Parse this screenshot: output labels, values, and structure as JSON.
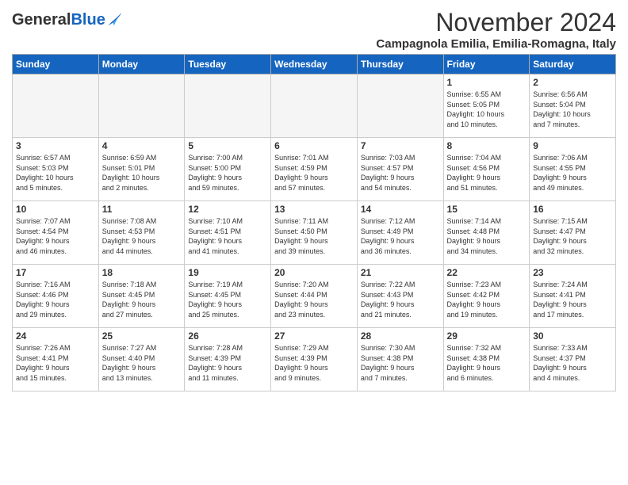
{
  "logo": {
    "general": "General",
    "blue": "Blue"
  },
  "title": "November 2024",
  "location": "Campagnola Emilia, Emilia-Romagna, Italy",
  "weekdays": [
    "Sunday",
    "Monday",
    "Tuesday",
    "Wednesday",
    "Thursday",
    "Friday",
    "Saturday"
  ],
  "weeks": [
    [
      {
        "day": null,
        "info": null
      },
      {
        "day": null,
        "info": null
      },
      {
        "day": null,
        "info": null
      },
      {
        "day": null,
        "info": null
      },
      {
        "day": null,
        "info": null
      },
      {
        "day": "1",
        "info": "Sunrise: 6:55 AM\nSunset: 5:05 PM\nDaylight: 10 hours\nand 10 minutes."
      },
      {
        "day": "2",
        "info": "Sunrise: 6:56 AM\nSunset: 5:04 PM\nDaylight: 10 hours\nand 7 minutes."
      }
    ],
    [
      {
        "day": "3",
        "info": "Sunrise: 6:57 AM\nSunset: 5:03 PM\nDaylight: 10 hours\nand 5 minutes."
      },
      {
        "day": "4",
        "info": "Sunrise: 6:59 AM\nSunset: 5:01 PM\nDaylight: 10 hours\nand 2 minutes."
      },
      {
        "day": "5",
        "info": "Sunrise: 7:00 AM\nSunset: 5:00 PM\nDaylight: 9 hours\nand 59 minutes."
      },
      {
        "day": "6",
        "info": "Sunrise: 7:01 AM\nSunset: 4:59 PM\nDaylight: 9 hours\nand 57 minutes."
      },
      {
        "day": "7",
        "info": "Sunrise: 7:03 AM\nSunset: 4:57 PM\nDaylight: 9 hours\nand 54 minutes."
      },
      {
        "day": "8",
        "info": "Sunrise: 7:04 AM\nSunset: 4:56 PM\nDaylight: 9 hours\nand 51 minutes."
      },
      {
        "day": "9",
        "info": "Sunrise: 7:06 AM\nSunset: 4:55 PM\nDaylight: 9 hours\nand 49 minutes."
      }
    ],
    [
      {
        "day": "10",
        "info": "Sunrise: 7:07 AM\nSunset: 4:54 PM\nDaylight: 9 hours\nand 46 minutes."
      },
      {
        "day": "11",
        "info": "Sunrise: 7:08 AM\nSunset: 4:53 PM\nDaylight: 9 hours\nand 44 minutes."
      },
      {
        "day": "12",
        "info": "Sunrise: 7:10 AM\nSunset: 4:51 PM\nDaylight: 9 hours\nand 41 minutes."
      },
      {
        "day": "13",
        "info": "Sunrise: 7:11 AM\nSunset: 4:50 PM\nDaylight: 9 hours\nand 39 minutes."
      },
      {
        "day": "14",
        "info": "Sunrise: 7:12 AM\nSunset: 4:49 PM\nDaylight: 9 hours\nand 36 minutes."
      },
      {
        "day": "15",
        "info": "Sunrise: 7:14 AM\nSunset: 4:48 PM\nDaylight: 9 hours\nand 34 minutes."
      },
      {
        "day": "16",
        "info": "Sunrise: 7:15 AM\nSunset: 4:47 PM\nDaylight: 9 hours\nand 32 minutes."
      }
    ],
    [
      {
        "day": "17",
        "info": "Sunrise: 7:16 AM\nSunset: 4:46 PM\nDaylight: 9 hours\nand 29 minutes."
      },
      {
        "day": "18",
        "info": "Sunrise: 7:18 AM\nSunset: 4:45 PM\nDaylight: 9 hours\nand 27 minutes."
      },
      {
        "day": "19",
        "info": "Sunrise: 7:19 AM\nSunset: 4:45 PM\nDaylight: 9 hours\nand 25 minutes."
      },
      {
        "day": "20",
        "info": "Sunrise: 7:20 AM\nSunset: 4:44 PM\nDaylight: 9 hours\nand 23 minutes."
      },
      {
        "day": "21",
        "info": "Sunrise: 7:22 AM\nSunset: 4:43 PM\nDaylight: 9 hours\nand 21 minutes."
      },
      {
        "day": "22",
        "info": "Sunrise: 7:23 AM\nSunset: 4:42 PM\nDaylight: 9 hours\nand 19 minutes."
      },
      {
        "day": "23",
        "info": "Sunrise: 7:24 AM\nSunset: 4:41 PM\nDaylight: 9 hours\nand 17 minutes."
      }
    ],
    [
      {
        "day": "24",
        "info": "Sunrise: 7:26 AM\nSunset: 4:41 PM\nDaylight: 9 hours\nand 15 minutes."
      },
      {
        "day": "25",
        "info": "Sunrise: 7:27 AM\nSunset: 4:40 PM\nDaylight: 9 hours\nand 13 minutes."
      },
      {
        "day": "26",
        "info": "Sunrise: 7:28 AM\nSunset: 4:39 PM\nDaylight: 9 hours\nand 11 minutes."
      },
      {
        "day": "27",
        "info": "Sunrise: 7:29 AM\nSunset: 4:39 PM\nDaylight: 9 hours\nand 9 minutes."
      },
      {
        "day": "28",
        "info": "Sunrise: 7:30 AM\nSunset: 4:38 PM\nDaylight: 9 hours\nand 7 minutes."
      },
      {
        "day": "29",
        "info": "Sunrise: 7:32 AM\nSunset: 4:38 PM\nDaylight: 9 hours\nand 6 minutes."
      },
      {
        "day": "30",
        "info": "Sunrise: 7:33 AM\nSunset: 4:37 PM\nDaylight: 9 hours\nand 4 minutes."
      }
    ]
  ]
}
